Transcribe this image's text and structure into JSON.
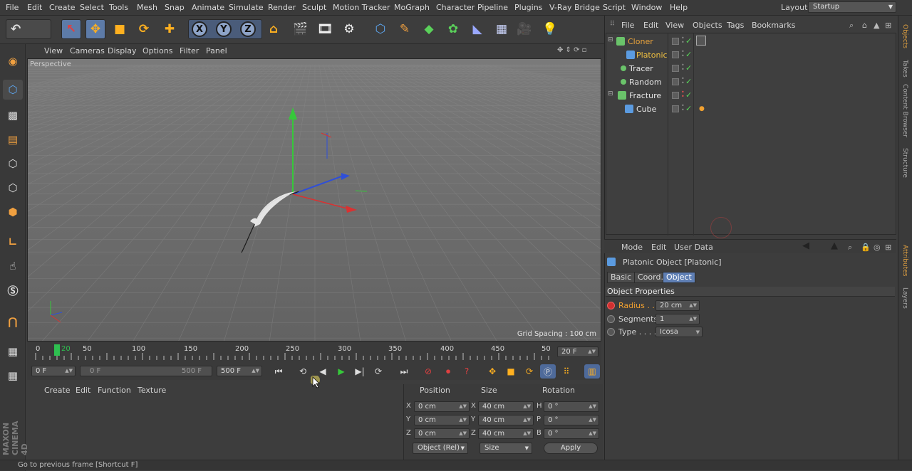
{
  "menubar": {
    "items": [
      "File",
      "Edit",
      "Create",
      "Select",
      "Tools",
      "Mesh",
      "Snap",
      "Animate",
      "Simulate",
      "Render",
      "Sculpt",
      "Motion Tracker",
      "MoGraph",
      "Character",
      "Pipeline",
      "Plugins",
      "V-Ray Bridge",
      "Script",
      "Window",
      "Help"
    ],
    "layout_label": "Layout:",
    "layout_value": "Startup"
  },
  "toolbar": {
    "icons": [
      "undo-icon",
      "redo-icon",
      "live-selection-icon",
      "move-icon",
      "scale-icon",
      "rotate-icon",
      "recent-tool-icon",
      "x-axis-icon",
      "y-axis-icon",
      "z-axis-icon",
      "coordinate-system-icon",
      "render-view-icon",
      "render-picture-viewer-icon",
      "edit-render-settings-icon",
      "cube-icon",
      "pen-icon",
      "subdivision-icon",
      "cloner-icon",
      "deformer-icon",
      "floor-icon",
      "camera-icon",
      "light-icon"
    ],
    "axis_labels": [
      "X",
      "Y",
      "Z"
    ]
  },
  "viewport": {
    "menu": [
      "View",
      "Cameras",
      "Display",
      "Options",
      "Filter",
      "Panel"
    ],
    "label": "Perspective",
    "grid_spacing": "Grid Spacing : 100 cm",
    "background": "#6f6f6f"
  },
  "timeline": {
    "ticks": [
      "0",
      "50",
      "100",
      "150",
      "200",
      "250",
      "300",
      "350",
      "400",
      "450",
      "50"
    ],
    "playhead_label": "20",
    "current_frame": "20 F"
  },
  "anim": {
    "start_frame": "0 F",
    "min_frame": "0 F",
    "max_frame": "500 F",
    "end_frame": "500 F"
  },
  "material": {
    "menu": [
      "Create",
      "Edit",
      "Function",
      "Texture"
    ]
  },
  "coords": {
    "headers": [
      "Position",
      "Size",
      "Rotation"
    ],
    "rows": [
      {
        "axis": "X",
        "pos": "0 cm",
        "size_axis": "X",
        "size": "40 cm",
        "rot_axis": "H",
        "rot": "0 °"
      },
      {
        "axis": "Y",
        "pos": "0 cm",
        "size_axis": "Y",
        "size": "40 cm",
        "rot_axis": "P",
        "rot": "0 °"
      },
      {
        "axis": "Z",
        "pos": "0 cm",
        "size_axis": "Z",
        "size": "40 cm",
        "rot_axis": "B",
        "rot": "0 °"
      }
    ],
    "mode": "Object (Rel)",
    "size_mode": "Size",
    "apply": "Apply"
  },
  "object_manager": {
    "menu": [
      "File",
      "Edit",
      "View",
      "Objects",
      "Tags",
      "Bookmarks"
    ],
    "objects": [
      {
        "name": "Cloner",
        "color": "#e8a23c",
        "icon_color": "#6ac36a"
      },
      {
        "name": "Platonic",
        "color": "#f0c040",
        "icon_color": "#5b9be0"
      },
      {
        "name": "Tracer",
        "color": "#e6e6e6",
        "icon_color": "#6ac36a"
      },
      {
        "name": "Random",
        "color": "#e6e6e6",
        "icon_color": "#6ac36a"
      },
      {
        "name": "Fracture",
        "color": "#e6e6e6",
        "icon_color": "#6ac36a"
      },
      {
        "name": "Cube",
        "color": "#e6e6e6",
        "icon_color": "#5b9be0"
      }
    ]
  },
  "attributes": {
    "menu": [
      "Mode",
      "Edit",
      "User Data"
    ],
    "title": "Platonic Object [Platonic]",
    "tabs": [
      "Basic",
      "Coord.",
      "Object"
    ],
    "active_tab": "Object",
    "section": "Object Properties",
    "props": [
      {
        "label": "Radius . .",
        "value": "20 cm",
        "color": "#f0a030"
      },
      {
        "label": "Segments",
        "value": "1",
        "color": "#d4d4d4"
      },
      {
        "label": "Type . . . .",
        "value": "Icosa",
        "color": "#d4d4d4"
      }
    ]
  },
  "right_strip": [
    "Objects",
    "Takes",
    "Content Browser",
    "Structure",
    "Attributes",
    "Layers"
  ],
  "status": "Go to previous frame [Shortcut F]",
  "brand": "MAXON CINEMA 4D"
}
